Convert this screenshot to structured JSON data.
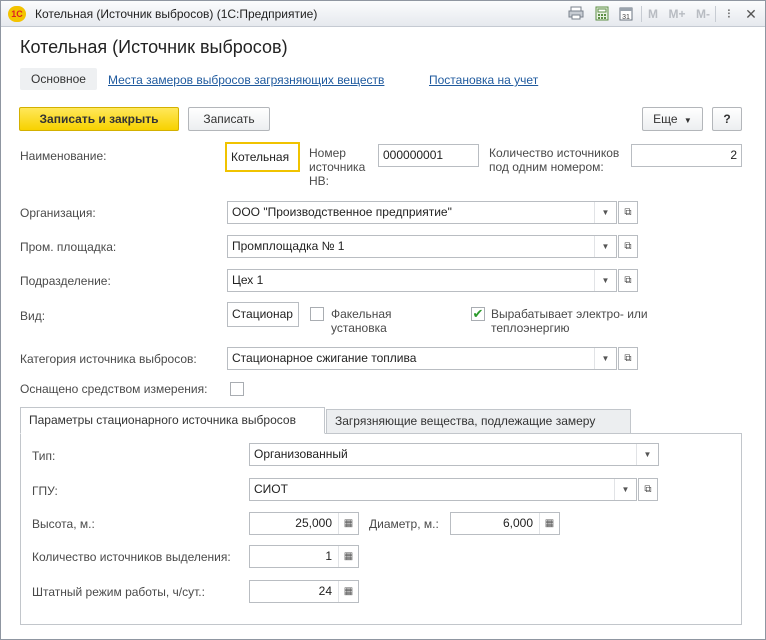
{
  "window": {
    "title": "Котельная (Источник выбросов)  (1С:Предприятие)",
    "toolbar_icons": [
      "print-icon",
      "calculator-icon",
      "calendar-icon"
    ],
    "memory_buttons": [
      "M",
      "M+",
      "M-"
    ],
    "controls": [
      "−",
      "□",
      "✕"
    ]
  },
  "form": {
    "title": "Котельная (Источник выбросов)",
    "nav": [
      "Основное",
      "Места замеров выбросов загрязняющих веществ",
      "Постановка на учет"
    ],
    "buttons": {
      "save_close": "Записать и закрыть",
      "save": "Записать",
      "more": "Еще",
      "help": "?"
    }
  },
  "fields": {
    "name_label": "Наименование:",
    "name_value": "Котельная",
    "number_label": "Номер источника НВ:",
    "number_value": "000000001",
    "count_label": "Количество источников под одним номером:",
    "count_value": "2",
    "org_label": "Организация:",
    "org_value": "ООО \"Производственное предприятие\"",
    "site_label": "Пром. площадка:",
    "site_value": "Промплощадка № 1",
    "dept_label": "Подразделение:",
    "dept_value": "Цех 1",
    "kind_label": "Вид:",
    "kind_value": "Стационар",
    "flare_label": "Факельная установка",
    "flare_checked": false,
    "energy_label": "Вырабатывает электро- или теплоэнергию",
    "energy_checked": true,
    "category_label": "Категория источника выбросов:",
    "category_value": "Стационарное сжигание топлива",
    "meter_label": "Оснащено средством измерения:",
    "meter_checked": false
  },
  "tabs": [
    "Параметры стационарного источника выбросов",
    "Загрязняющие вещества, подлежащие замеру"
  ],
  "params": {
    "type_label": "Тип:",
    "type_value": "Организованный",
    "gpu_label": "ГПУ:",
    "gpu_value": "СИОТ",
    "height_label": "Высота, м.:",
    "height_value": "25,000",
    "diameter_label": "Диаметр, м.:",
    "diameter_value": "6,000",
    "sources_label": "Количество источников выделения:",
    "sources_value": "1",
    "mode_label": "Штатный режим работы, ч/сут.:",
    "mode_value": "24"
  },
  "colors": {
    "primary_button": "#f7d200",
    "link": "#1f5a9e",
    "checkmark": "#2b9a2b"
  }
}
